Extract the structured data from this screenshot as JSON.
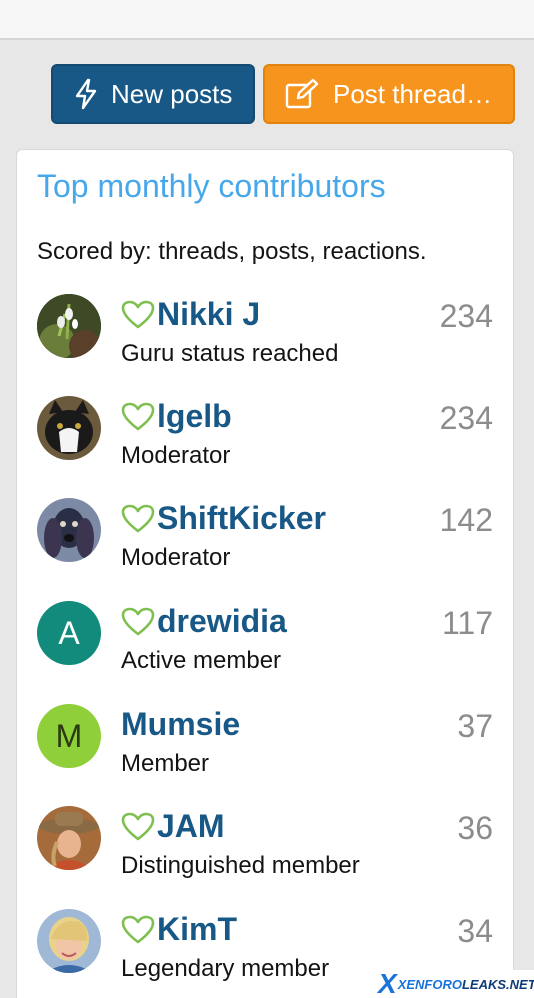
{
  "buttons": {
    "new_posts": {
      "label": "New posts",
      "icon": "lightning-icon"
    },
    "post_thread": {
      "label": "Post thread…",
      "icon": "edit-icon"
    }
  },
  "widget": {
    "title": "Top monthly contributors",
    "subtitle": "Scored by: threads, posts, reactions.",
    "members": [
      {
        "name": "Nikki J",
        "rank": "Guru status reached",
        "score": "234",
        "heart": true,
        "avatar": "photo-snowdrops"
      },
      {
        "name": "lgelb",
        "rank": "Moderator",
        "score": "234",
        "heart": true,
        "avatar": "photo-cat"
      },
      {
        "name": "ShiftKicker",
        "rank": "Moderator",
        "score": "142",
        "heart": true,
        "avatar": "photo-dog"
      },
      {
        "name": "drewidia",
        "rank": "Active member",
        "score": "117",
        "heart": true,
        "avatar_letter": "A",
        "avatar_color": "#128b7c"
      },
      {
        "name": "Mumsie",
        "rank": "Member",
        "score": "37",
        "heart": false,
        "avatar_letter": "M",
        "avatar_color": "#8fcf3a"
      },
      {
        "name": "JAM",
        "rank": "Distinguished member",
        "score": "36",
        "heart": true,
        "avatar": "photo-hat"
      },
      {
        "name": "KimT",
        "rank": "Legendary member",
        "score": "34",
        "heart": true,
        "avatar": "photo-blonde"
      }
    ]
  },
  "watermark": {
    "x": "X",
    "part1": "XENFORO",
    "part2": "LEAKS.NET"
  },
  "colors": {
    "primary": "#185886",
    "accent_orange": "#f7941d",
    "title_blue": "#47a7eb",
    "heart_green": "#7ebf4f"
  }
}
